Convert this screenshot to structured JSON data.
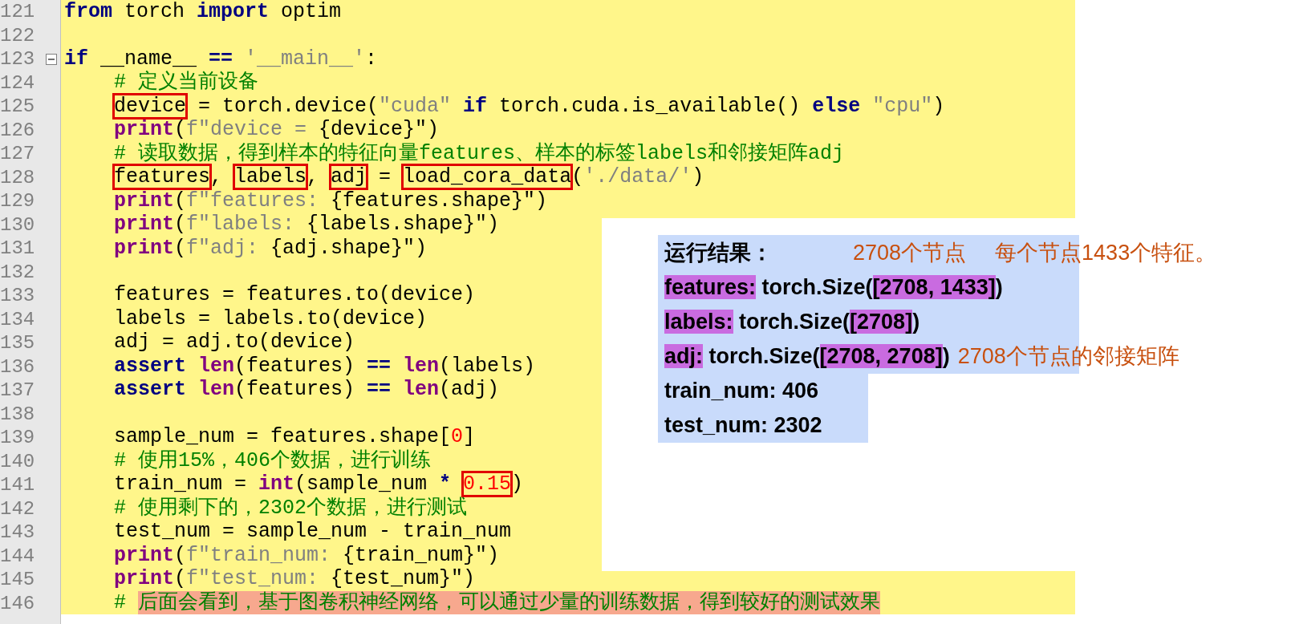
{
  "editor": {
    "lines": [
      {
        "number": "121",
        "tokens": [
          {
            "kind": "kw",
            "text": "from"
          },
          {
            "kind": "plain",
            "text": " torch "
          },
          {
            "kind": "kw",
            "text": "import"
          },
          {
            "kind": "plain",
            "text": " optim"
          }
        ]
      },
      {
        "number": "122"
      },
      {
        "number": "123",
        "fold": true,
        "tokens": [
          {
            "kind": "kw",
            "text": "if"
          },
          {
            "kind": "plain",
            "text": " __name__ "
          },
          {
            "kind": "kw",
            "text": "=="
          },
          {
            "kind": "str",
            "text": " '__main__'"
          },
          {
            "kind": "plain",
            "text": ":"
          }
        ]
      },
      {
        "number": "124",
        "indented": true,
        "tokens": [
          {
            "kind": "cmt",
            "text": "# 定义当前设备"
          }
        ]
      },
      {
        "number": "125",
        "indented": true,
        "tokens": [
          {
            "kind": "plain",
            "text": "device",
            "boxed": true
          },
          {
            "kind": "plain",
            "text": " = torch.device("
          },
          {
            "kind": "str",
            "text": "\"cuda\" "
          },
          {
            "kind": "kw",
            "text": "if"
          },
          {
            "kind": "plain",
            "text": " torch.cuda.is_available() "
          },
          {
            "kind": "kw",
            "text": "else"
          },
          {
            "kind": "str",
            "text": " \"cpu\""
          },
          {
            "kind": "plain",
            "text": ")"
          }
        ]
      },
      {
        "number": "126",
        "indented": true,
        "tokens": [
          {
            "kind": "fn",
            "text": "print"
          },
          {
            "kind": "plain",
            "text": "("
          },
          {
            "kind": "str",
            "text": "f\"device = "
          },
          {
            "kind": "plain",
            "text": "{device}\")"
          }
        ]
      },
      {
        "number": "127",
        "indented": true,
        "tokens": [
          {
            "kind": "cmt",
            "text": "# 读取数据，得到样本的特征向量features、样本的标签labels和邻接矩阵adj"
          }
        ]
      },
      {
        "number": "128",
        "indented": true,
        "tokens": [
          {
            "kind": "plain",
            "text": "features",
            "boxed": true
          },
          {
            "kind": "plain",
            "text": ", "
          },
          {
            "kind": "plain",
            "text": "labels",
            "boxed": true
          },
          {
            "kind": "plain",
            "text": ", "
          },
          {
            "kind": "plain",
            "text": "adj",
            "boxed": true
          },
          {
            "kind": "plain",
            "text": " = "
          },
          {
            "kind": "plain",
            "text": "load_cora_data",
            "boxed": true
          },
          {
            "kind": "plain",
            "text": "("
          },
          {
            "kind": "str",
            "text": "'./data/'"
          },
          {
            "kind": "plain",
            "text": ")"
          }
        ]
      },
      {
        "number": "129",
        "indented": true,
        "tokens": [
          {
            "kind": "fn",
            "text": "print"
          },
          {
            "kind": "plain",
            "text": "("
          },
          {
            "kind": "str",
            "text": "f\"features: "
          },
          {
            "kind": "plain",
            "text": "{features.shape}\")"
          }
        ]
      },
      {
        "number": "130",
        "indented": true,
        "tokens": [
          {
            "kind": "fn",
            "text": "print"
          },
          {
            "kind": "plain",
            "text": "("
          },
          {
            "kind": "str",
            "text": "f\"labels: "
          },
          {
            "kind": "plain",
            "text": "{labels.shape}\")"
          }
        ]
      },
      {
        "number": "131",
        "indented": true,
        "tokens": [
          {
            "kind": "fn",
            "text": "print"
          },
          {
            "kind": "plain",
            "text": "("
          },
          {
            "kind": "str",
            "text": "f\"adj: "
          },
          {
            "kind": "plain",
            "text": "{adj.shape}\")"
          }
        ]
      },
      {
        "number": "132"
      },
      {
        "number": "133",
        "indented": true,
        "tokens": [
          {
            "kind": "plain",
            "text": "features = features.to(device)"
          }
        ]
      },
      {
        "number": "134",
        "indented": true,
        "tokens": [
          {
            "kind": "plain",
            "text": "labels = labels.to(device)"
          }
        ]
      },
      {
        "number": "135",
        "indented": true,
        "tokens": [
          {
            "kind": "plain",
            "text": "adj = adj.to(device)"
          }
        ]
      },
      {
        "number": "136",
        "indented": true,
        "tokens": [
          {
            "kind": "kw",
            "text": "assert"
          },
          {
            "kind": "fn",
            "text": " len"
          },
          {
            "kind": "plain",
            "text": "(features) "
          },
          {
            "kind": "kw",
            "text": "=="
          },
          {
            "kind": "fn",
            "text": " len"
          },
          {
            "kind": "plain",
            "text": "(labels)"
          }
        ]
      },
      {
        "number": "137",
        "indented": true,
        "tokens": [
          {
            "kind": "kw",
            "text": "assert"
          },
          {
            "kind": "fn",
            "text": " len"
          },
          {
            "kind": "plain",
            "text": "(features) "
          },
          {
            "kind": "kw",
            "text": "=="
          },
          {
            "kind": "fn",
            "text": " len"
          },
          {
            "kind": "plain",
            "text": "(adj)"
          }
        ]
      },
      {
        "number": "138"
      },
      {
        "number": "139",
        "indented": true,
        "tokens": [
          {
            "kind": "plain",
            "text": "sample_num = features.shape["
          },
          {
            "kind": "num",
            "text": "0"
          },
          {
            "kind": "plain",
            "text": "]"
          }
        ]
      },
      {
        "number": "140",
        "indented": true,
        "tokens": [
          {
            "kind": "cmt",
            "text": "# 使用15%，406个数据，进行训练"
          }
        ]
      },
      {
        "number": "141",
        "indented": true,
        "tokens": [
          {
            "kind": "plain",
            "text": "train_num = "
          },
          {
            "kind": "fn",
            "text": "int"
          },
          {
            "kind": "plain",
            "text": "(sample_num "
          },
          {
            "kind": "kw",
            "text": "* "
          },
          {
            "kind": "num",
            "text": "0.15",
            "boxed": true
          },
          {
            "kind": "plain",
            "text": ")"
          }
        ]
      },
      {
        "number": "142",
        "indented": true,
        "tokens": [
          {
            "kind": "cmt",
            "text": "# 使用剩下的，2302个数据，进行测试"
          }
        ]
      },
      {
        "number": "143",
        "indented": true,
        "tokens": [
          {
            "kind": "plain",
            "text": "test_num = sample_num - train_num"
          }
        ]
      },
      {
        "number": "144",
        "indented": true,
        "tokens": [
          {
            "kind": "fn",
            "text": "print"
          },
          {
            "kind": "plain",
            "text": "("
          },
          {
            "kind": "str",
            "text": "f\"train_num: "
          },
          {
            "kind": "plain",
            "text": "{train_num}\")"
          }
        ]
      },
      {
        "number": "145",
        "indented": true,
        "tokens": [
          {
            "kind": "fn",
            "text": "print"
          },
          {
            "kind": "plain",
            "text": "("
          },
          {
            "kind": "str",
            "text": "f\"test_num: "
          },
          {
            "kind": "plain",
            "text": "{test_num}\")"
          }
        ]
      },
      {
        "number": "146",
        "indented": true,
        "tokens": [
          {
            "kind": "cmt",
            "text": "# "
          },
          {
            "kind": "cmt",
            "text": "后面会看到，基于图卷积神经网络，可以通过少量的训练数据，得到较好的测试效果",
            "marked": true
          }
        ]
      }
    ]
  },
  "result": {
    "title": "运行结果：",
    "title_notes": [
      "2708个节点",
      "每个节点1433个特征。"
    ],
    "groups": [
      [
        {
          "segments": [
            {
              "text": "features:",
              "highlighted": true
            },
            {
              "text": " torch.Size(",
              "highlighted": false
            },
            {
              "text": "[2708, 1433]",
              "highlighted": true
            },
            {
              "text": ")",
              "highlighted": false
            }
          ]
        },
        {
          "segments": [
            {
              "text": "labels:",
              "highlighted": true
            },
            {
              "text": " torch.Size(",
              "highlighted": false
            },
            {
              "text": "[2708]",
              "highlighted": true
            },
            {
              "text": ")",
              "highlighted": false
            }
          ]
        },
        {
          "segments": [
            {
              "text": "adj:",
              "highlighted": true
            },
            {
              "text": " torch.Size(",
              "highlighted": false
            },
            {
              "text": "[2708, 2708]",
              "highlighted": true
            },
            {
              "text": ")",
              "highlighted": false
            }
          ],
          "note": "2708个节点的邻接矩阵"
        }
      ],
      [
        {
          "segments": [
            {
              "text": "train_num: 406",
              "highlighted": false
            }
          ]
        },
        {
          "segments": [
            {
              "text": "test_num: 2302",
              "highlighted": false
            }
          ]
        }
      ]
    ]
  }
}
